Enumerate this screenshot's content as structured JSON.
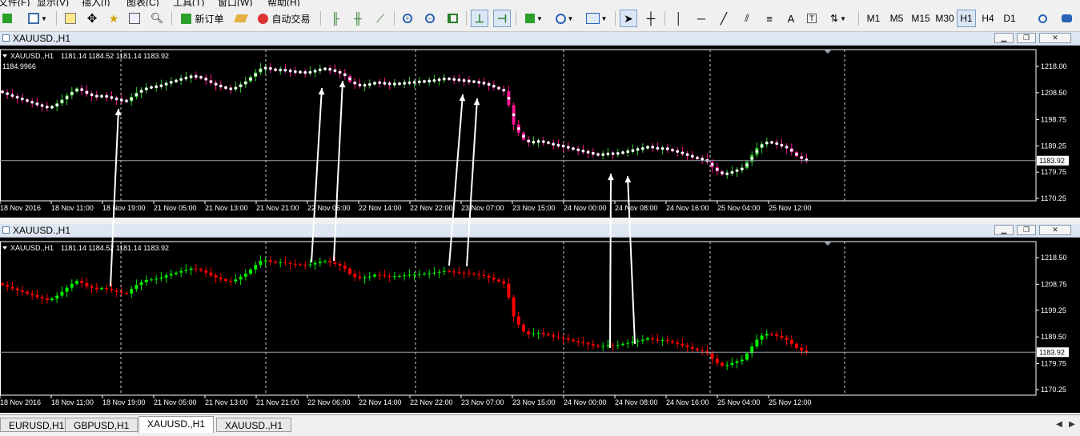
{
  "menu": [
    "文件(F)",
    "显示(V)",
    "插入(I)",
    "图表(C)",
    "工具(T)",
    "窗口(W)",
    "帮助(H)"
  ],
  "toolbar": {
    "new_order_label": "新订单",
    "auto_trade_label": "自动交易",
    "timeframes": [
      "M1",
      "M5",
      "M15",
      "M30",
      "H1",
      "H4",
      "D1"
    ],
    "active_timeframe": "H1"
  },
  "windows": [
    {
      "title": "XAUUSD.,H1",
      "info_symbol": "XAUUSD.,H1",
      "info_ohlc": "1181.14 1184.52 1181.14 1183.92",
      "indicator_value": "1184.9966",
      "price_labels": [
        "1218.00",
        "1208.50",
        "1198.75",
        "1189.25",
        "1179.75",
        "1170.25"
      ],
      "current_price": "1183.92",
      "bull_color": "#33cc33",
      "bear_color": "#ff1493",
      "dot_color": "#ffffff"
    },
    {
      "title": "XAUUSD.,H1",
      "info_symbol": "XAUUSD.,H1",
      "info_ohlc": "1181.14 1184.52 1181.14 1183.92",
      "price_labels": [
        "1218.50",
        "1208.75",
        "1199.25",
        "1189.50",
        "1179.75",
        "1170.25"
      ],
      "current_price": "1183.92",
      "bull_color": "#00ee00",
      "bear_color": "#ff0000"
    }
  ],
  "time_labels": [
    "18 Nov 2016",
    "18 Nov 11:00",
    "18 Nov 19:00",
    "21 Nov 05:00",
    "21 Nov 13:00",
    "21 Nov 21:00",
    "22 Nov 06:00",
    "22 Nov 14:00",
    "22 Nov 22:00",
    "23 Nov 07:00",
    "23 Nov 15:00",
    "24 Nov 00:00",
    "24 Nov 08:00",
    "24 Nov 16:00",
    "25 Nov 04:00",
    "25 Nov 12:00"
  ],
  "tabs": [
    "EURUSD,H1",
    "GBPUSD,H1",
    "XAUUSD.,H1",
    "XAUUSD.,H1"
  ],
  "active_tab_index": 2,
  "price_path": [
    1208.5,
    1207.8,
    1207.2,
    1206.5,
    1206.0,
    1205.3,
    1204.8,
    1204.1,
    1203.6,
    1203.0,
    1203.5,
    1204.6,
    1206.0,
    1207.5,
    1208.9,
    1210.0,
    1209.2,
    1208.0,
    1207.5,
    1207.0,
    1207.4,
    1207.0,
    1206.5,
    1206.0,
    1205.6,
    1205.4,
    1207.0,
    1208.5,
    1209.5,
    1210.3,
    1210.5,
    1210.8,
    1211.2,
    1212.0,
    1212.5,
    1213.0,
    1213.6,
    1214.0,
    1214.5,
    1214.3,
    1213.8,
    1213.0,
    1212.0,
    1211.2,
    1210.6,
    1210.0,
    1209.8,
    1210.5,
    1211.5,
    1212.6,
    1214.2,
    1215.8,
    1217.3,
    1217.5,
    1217.0,
    1216.6,
    1216.8,
    1216.5,
    1216.2,
    1216.0,
    1215.9,
    1215.7,
    1216.0,
    1216.5,
    1217.0,
    1217.2,
    1216.7,
    1216.2,
    1215.5,
    1214.5,
    1212.5,
    1211.5,
    1211.0,
    1211.3,
    1211.6,
    1212.2,
    1212.0,
    1211.8,
    1211.6,
    1211.7,
    1211.8,
    1212.0,
    1212.2,
    1212.3,
    1212.5,
    1212.6,
    1212.8,
    1213.0,
    1213.3,
    1213.6,
    1213.4,
    1213.2,
    1213.0,
    1212.8,
    1212.6,
    1212.4,
    1212.1,
    1211.8,
    1211.2,
    1210.5,
    1209.8,
    1209.0,
    1204.0,
    1197.0,
    1194.0,
    1191.5,
    1190.5,
    1190.7,
    1191.0,
    1190.6,
    1190.2,
    1189.6,
    1189.4,
    1189.0,
    1188.5,
    1188.0,
    1187.6,
    1187.2,
    1186.8,
    1186.3,
    1186.0,
    1186.2,
    1186.5,
    1186.4,
    1186.6,
    1187.0,
    1187.3,
    1187.8,
    1188.1,
    1188.5,
    1189.0,
    1188.6,
    1188.2,
    1188.4,
    1188.0,
    1187.5,
    1187.0,
    1186.4,
    1185.8,
    1185.2,
    1184.6,
    1184.4,
    1183.5,
    1181.5,
    1180.0,
    1179.0,
    1179.3,
    1180.0,
    1180.6,
    1181.2,
    1183.5,
    1186.0,
    1188.5,
    1190.0,
    1190.6,
    1190.4,
    1189.8,
    1189.2,
    1188.4,
    1187.0,
    1185.5,
    1184.5,
    1183.9
  ]
}
